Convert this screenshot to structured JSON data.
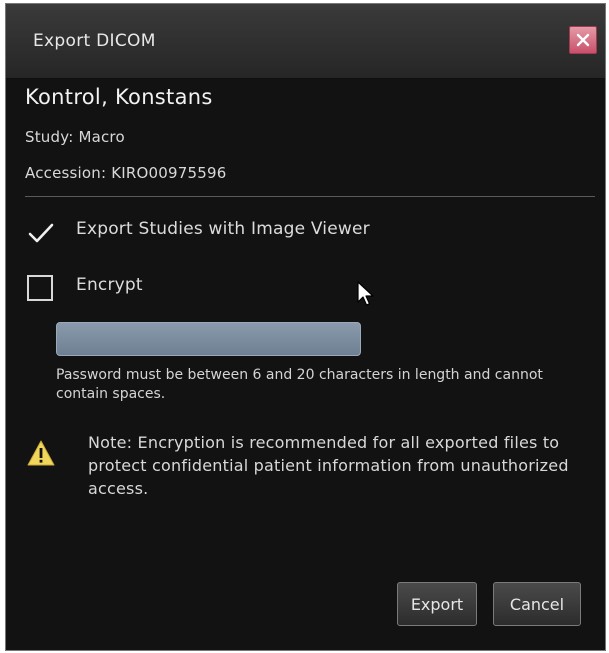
{
  "window": {
    "title": "Export DICOM",
    "close_icon": "close-x-icon"
  },
  "patient": {
    "name": "Kontrol, Konstans",
    "study": "Study: Macro",
    "accession": "Accession: KIRO00975596"
  },
  "options": {
    "export_with_viewer_label": "Export Studies with Image Viewer",
    "export_with_viewer_checked": true,
    "encrypt_label": "Encrypt",
    "encrypt_checked": false
  },
  "password": {
    "value": "",
    "hint": "Password must be between 6 and 20 characters in length and cannot contain spaces."
  },
  "note": {
    "icon": "warning-triangle-icon",
    "text": "Note: Encryption is recommended for all exported files to protect confidential patient information from unauthorized access."
  },
  "buttons": {
    "export_label": "Export",
    "cancel_label": "Cancel"
  },
  "colors": {
    "background": "#121212",
    "close_button": "#d05a73",
    "password_field": "#7d8da0",
    "warning": "#f0d65a"
  }
}
